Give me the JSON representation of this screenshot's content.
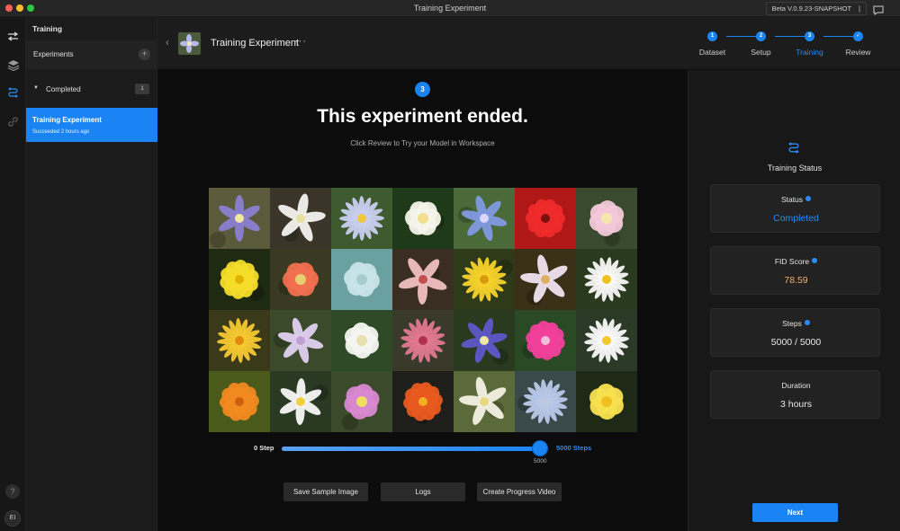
{
  "window": {
    "title": "Training Experiment",
    "version": "Beta V.0.9.23-SNAPSHOT"
  },
  "left_panel": {
    "title": "Training",
    "experiments_label": "Experiments",
    "group": {
      "label": "Completed",
      "count": "1"
    },
    "selected_item": {
      "name": "Training Experiment",
      "status": "Succeeded 2 hours ago"
    }
  },
  "header": {
    "title": "Training Experiment",
    "more": "···",
    "steps": [
      {
        "number": "1",
        "label": "Dataset",
        "state": "done"
      },
      {
        "number": "2",
        "label": "Setup",
        "state": "done"
      },
      {
        "number": "3",
        "label": "Training",
        "state": "active"
      },
      {
        "number": "✓",
        "label": "Review",
        "state": "done"
      }
    ]
  },
  "main": {
    "step_badge": "3",
    "heading": "This experiment ended.",
    "subheading": "Click Review to Try your Model in Workspace",
    "slider": {
      "min_label": "0 Step",
      "max_label": "5000 Steps",
      "value_label": "5000",
      "value": 5000,
      "max": 5000
    },
    "buttons": {
      "save": "Save Sample Image",
      "logs": "Logs",
      "video": "Create Progress Video"
    },
    "samples": [
      {
        "bg": "#5b5a3a",
        "petal": "#8a7fd0",
        "center": "#f2e6a0",
        "shape": "star"
      },
      {
        "bg": "#3a3528",
        "petal": "#f3f3f0",
        "center": "#e8e0a0",
        "shape": "lily"
      },
      {
        "bg": "#3e5a2e",
        "petal": "#c8d0f0",
        "center": "#f0c840",
        "shape": "daisy"
      },
      {
        "bg": "#1f3a18",
        "petal": "#f6f4ea",
        "center": "#f0e090",
        "shape": "cup"
      },
      {
        "bg": "#4a6a3a",
        "petal": "#7f9ae0",
        "center": "#d8d8ff",
        "shape": "star"
      },
      {
        "bg": "#b01818",
        "petal": "#ee2a2a",
        "center": "#7a1010",
        "shape": "ruffle"
      },
      {
        "bg": "#3a4a2e",
        "petal": "#f2c8d8",
        "center": "#f6e6b0",
        "shape": "cup"
      },
      {
        "bg": "#1e2a12",
        "petal": "#f4dc2a",
        "center": "#e0b400",
        "shape": "ruffle"
      },
      {
        "bg": "#3a3a22",
        "petal": "#f07050",
        "center": "#e8d070",
        "shape": "cup"
      },
      {
        "bg": "#6aa0a0",
        "petal": "#c8e4e8",
        "center": "#a8cccc",
        "shape": "cup"
      },
      {
        "bg": "#3a2e22",
        "petal": "#f0c0c0",
        "center": "#c05050",
        "shape": "lily"
      },
      {
        "bg": "#2e3a1a",
        "petal": "#f6d22a",
        "center": "#d89a10",
        "shape": "daisy"
      },
      {
        "bg": "#3a3018",
        "petal": "#f0e4f0",
        "center": "#e0b060",
        "shape": "lily"
      },
      {
        "bg": "#2a3a1e",
        "petal": "#f8f8f8",
        "center": "#f0c020",
        "shape": "daisy"
      },
      {
        "bg": "#3a3a1a",
        "petal": "#f4c830",
        "center": "#e08a10",
        "shape": "daisy"
      },
      {
        "bg": "#3a4a2a",
        "petal": "#e0d0f0",
        "center": "#c0a0d0",
        "shape": "star"
      },
      {
        "bg": "#2e4a26",
        "petal": "#f4f4f0",
        "center": "#e8e0b0",
        "shape": "cup"
      },
      {
        "bg": "#3a3a2a",
        "petal": "#e07890",
        "center": "#b03050",
        "shape": "daisy"
      },
      {
        "bg": "#2a3a1e",
        "petal": "#5c58c8",
        "center": "#f0e8a0",
        "shape": "star"
      },
      {
        "bg": "#2a4a26",
        "petal": "#f0409a",
        "center": "#f0c0d8",
        "shape": "ruffle"
      },
      {
        "bg": "#2a3a26",
        "petal": "#f8f8f8",
        "center": "#f0c830",
        "shape": "daisy"
      },
      {
        "bg": "#4a5a1a",
        "petal": "#f08a20",
        "center": "#d06010",
        "shape": "ruffle"
      },
      {
        "bg": "#2a3a22",
        "petal": "#f8f8f8",
        "center": "#f0d040",
        "shape": "star"
      },
      {
        "bg": "#3a4a2a",
        "petal": "#d888d0",
        "center": "#f0e060",
        "shape": "cup"
      },
      {
        "bg": "#1e1e1a",
        "petal": "#e85a20",
        "center": "#f0b020",
        "shape": "ruffle"
      },
      {
        "bg": "#5a6a3a",
        "petal": "#f4f2e4",
        "center": "#e8d880",
        "shape": "lily"
      },
      {
        "bg": "#3a4a4a",
        "petal": "#b8c8e8",
        "center": "#c0c8e0",
        "shape": "daisy"
      },
      {
        "bg": "#1e2a16",
        "petal": "#f8e050",
        "center": "#f0c020",
        "shape": "cup"
      }
    ]
  },
  "right_panel": {
    "title": "Training Status",
    "cards": [
      {
        "label": "Status",
        "value": "Completed",
        "info": true,
        "value_color": "#2b8cf5"
      },
      {
        "label": "FID Score",
        "value": "78.59",
        "info": true,
        "value_color": "#f0b070"
      },
      {
        "label": "Steps",
        "value": "5000 / 5000",
        "info": true,
        "value_color": "#e8e8e8"
      },
      {
        "label": "Duration",
        "value": "3 hours",
        "info": false,
        "value_color": "#e8e8e8"
      }
    ],
    "next_label": "Next"
  },
  "colors": {
    "accent": "#1a84f4",
    "background": "#111111"
  }
}
